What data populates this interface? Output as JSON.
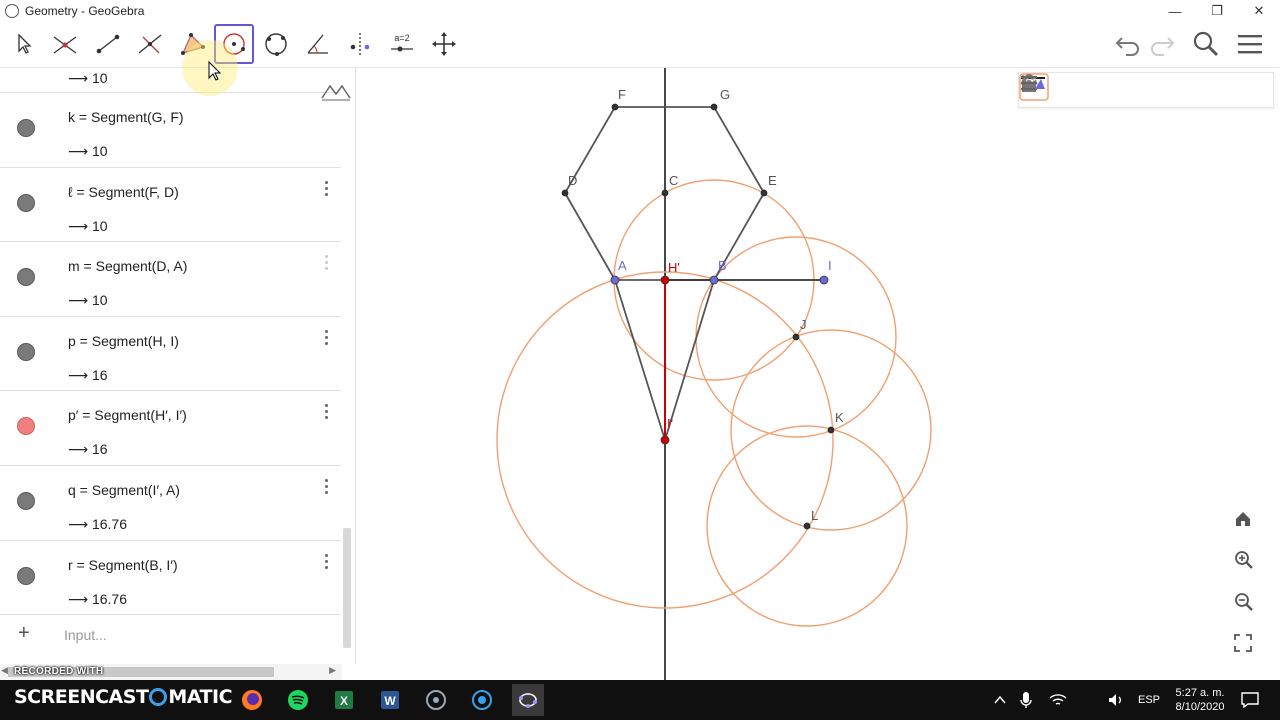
{
  "window": {
    "title": "Geometry - GeoGebra",
    "minimize": "—",
    "restore": "❐",
    "close": "✕"
  },
  "toolbar": {
    "tools": [
      {
        "name": "move-tool",
        "active": false
      },
      {
        "name": "point-intersect-tool",
        "active": false
      },
      {
        "name": "segment-tool",
        "active": false
      },
      {
        "name": "perpendicular-line-tool",
        "active": false
      },
      {
        "name": "polygon-tool",
        "active": false
      },
      {
        "name": "circle-center-point-tool",
        "active": true
      },
      {
        "name": "circle-through-points-tool",
        "active": false
      },
      {
        "name": "angle-tool",
        "active": false
      },
      {
        "name": "reflect-tool",
        "active": false
      },
      {
        "name": "slider-tool",
        "active": false
      },
      {
        "name": "move-graphics-tool",
        "active": false
      }
    ],
    "slider_label": "a=2"
  },
  "algebra": {
    "top_value": "⟶  10",
    "rows": [
      {
        "def": "k  =  Segment(G, F)",
        "val": "⟶  10",
        "color": "#7a7a7a"
      },
      {
        "def": "ℓ  =  Segment(F, D)",
        "val": "⟶  10",
        "color": "#7a7a7a"
      },
      {
        "def": "m  =  Segment(D, A)",
        "val": "⟶  10",
        "color": "#7a7a7a"
      },
      {
        "def": "p  =  Segment(H, I)",
        "val": "⟶  16",
        "color": "#7a7a7a"
      },
      {
        "def": "p′  =  Segment(H′, I′)",
        "val": "⟶  16",
        "color": "#ef8080"
      },
      {
        "def": "q  =  Segment(I′, A)",
        "val": "⟶  16.76",
        "color": "#7a7a7a"
      },
      {
        "def": "r  =  Segment(B, I′)",
        "val": "⟶  16.76",
        "color": "#7a7a7a"
      }
    ],
    "input_placeholder": "Input...",
    "plus": "+"
  },
  "graphics": {
    "colors": {
      "circle": "#f0a070",
      "segment": "#555555",
      "red": "#cc0000",
      "blue": "#6b6bd6"
    },
    "labels": {
      "F": "F",
      "G": "G",
      "D": "D",
      "C": "C",
      "E": "E",
      "A": "A",
      "B": "B",
      "Hp": "H'",
      "I": "I",
      "J": "J",
      "K": "K",
      "L": "L",
      "Ip": "I'"
    }
  },
  "taskbar": {
    "recorded_with": "RECORDED WITH",
    "screencast_a": "SCREENCAST",
    "screencast_b": "MATIC",
    "lang": "ESP",
    "time": "5:27 a. m.",
    "date": "8/10/2020"
  }
}
